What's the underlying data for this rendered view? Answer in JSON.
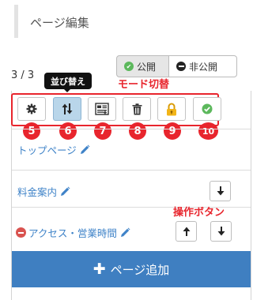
{
  "header": {
    "title": "ページ編集"
  },
  "page_count": "3 / 3",
  "publish": {
    "public_label": "公開",
    "private_label": "非公開"
  },
  "tooltip": "並び替え",
  "annotations": {
    "mode_switch": "モード切替",
    "operation_buttons": "操作ボタン"
  },
  "toolbar": {
    "badges": [
      "5",
      "6",
      "7",
      "8",
      "9",
      "10"
    ]
  },
  "pages": [
    {
      "title": "トップページ"
    },
    {
      "title": "料金案内"
    },
    {
      "title": "アクセス・営業時間"
    }
  ],
  "add_button": {
    "label": "ページ追加"
  },
  "colors": {
    "annotation_red": "#e8252d",
    "link_blue": "#3f83c8",
    "add_button_blue": "#3f7fc1",
    "active_tool": "#b9d6ea",
    "public_green": "#5cb85c"
  }
}
